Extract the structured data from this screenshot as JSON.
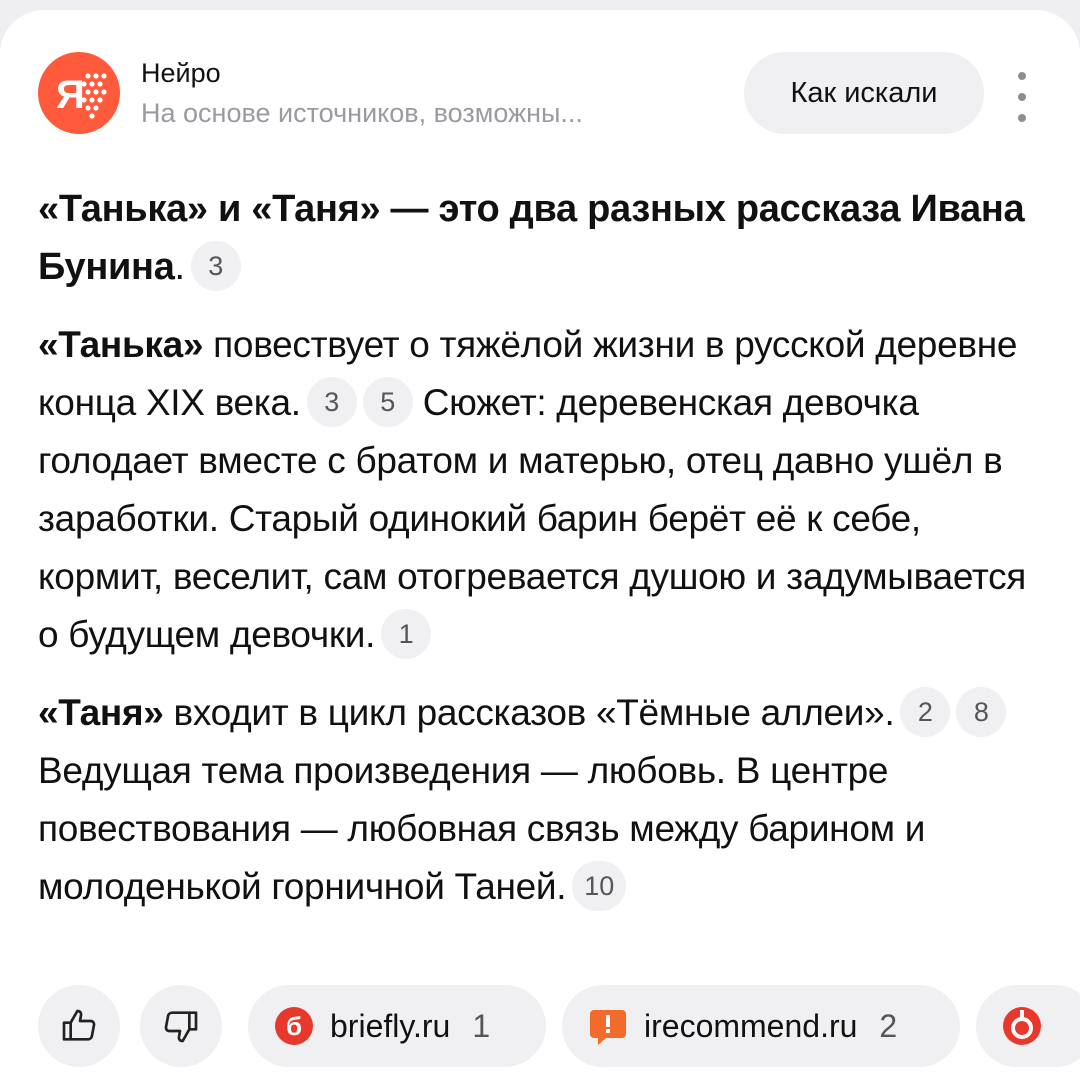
{
  "header": {
    "title": "Нейро",
    "subtitle": "На основе источников, возможны...",
    "how_button": "Как искали"
  },
  "answer": {
    "heading": {
      "text": "«Танька» и «Таня» — это два разных рассказа Ивана Бунина",
      "end": ".",
      "refs": [
        "3"
      ]
    },
    "para1": {
      "bold": "«Танька»",
      "text_a": " повествует о тяжёлой жизни в русской деревне конца XIX века.",
      "refs_a": [
        "3",
        "5"
      ],
      "text_b": " Сюжет: деревенская девочка голодает вместе с братом и матерью, отец давно ушёл в заработки. Старый одинокий барин берёт её к себе, кормит, веселит, сам отогревается душою и задумывается о будущем девочки.",
      "refs_b": [
        "1"
      ]
    },
    "para2": {
      "bold": "«Таня»",
      "text_a": " входит в цикл рассказов «Тёмные аллеи».",
      "refs_a": [
        "2",
        "8"
      ],
      "text_b": " Ведущая тема произведения — любовь. В центре повествования — любовная связь между барином и молоденькой горничной Таней.",
      "refs_b": [
        "10"
      ]
    }
  },
  "sources": [
    {
      "name": "briefly.ru",
      "num": "1",
      "icon": "briefly-icon",
      "color": "#e8382c"
    },
    {
      "name": "irecommend.ru",
      "num": "2",
      "icon": "irecommend-icon",
      "color": "#f26b2b"
    },
    {
      "name": "",
      "num": "",
      "icon": "source-3-icon",
      "color": "#e8382c"
    }
  ],
  "colors": {
    "brand": "#ff5a3c",
    "chip_bg": "#f0f0f2",
    "muted": "#9a9aa0"
  }
}
